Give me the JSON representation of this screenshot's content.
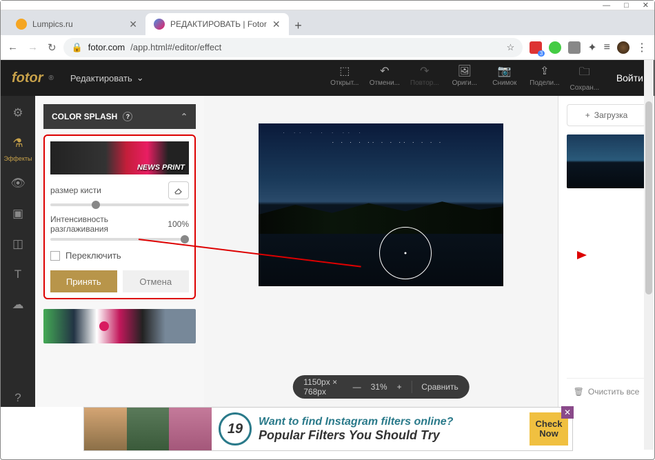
{
  "window": {
    "minimize": "—",
    "maximize": "□",
    "close": "✕"
  },
  "tabs": {
    "items": [
      {
        "label": "Lumpics.ru",
        "favicon": "#f5a623"
      },
      {
        "label": "РЕДАКТИРОВАТЬ | Fotor",
        "favicon": "#4a90e2"
      }
    ],
    "close": "✕",
    "new": "+"
  },
  "address": {
    "back": "←",
    "fwd": "→",
    "reload": "↻",
    "lock": "🔒",
    "domain": "fotor.com",
    "path": "/app.html#/editor/effect",
    "star": "☆"
  },
  "topbar": {
    "logo": "fotor",
    "reg": "®",
    "edit": "Редактировать",
    "chev": "⌄",
    "tools": [
      {
        "icon": "⬚",
        "label": "Открыт..."
      },
      {
        "icon": "↶",
        "label": "Отмени..."
      },
      {
        "icon": "↷",
        "label": "Повтор..."
      },
      {
        "icon": "🖼",
        "label": "Ориги..."
      },
      {
        "icon": "📷",
        "label": "Снимок"
      },
      {
        "icon": "⇪",
        "label": "Подели..."
      },
      {
        "icon": "🗀",
        "label": "Сохран..."
      }
    ],
    "login": "Войти"
  },
  "sidebar": {
    "active_label": "Эффекты",
    "icons": [
      "⚙",
      "⚗",
      "👁",
      "▣",
      "◫",
      "T",
      "☁",
      "?"
    ]
  },
  "panel": {
    "title": "COLOR SPLASH",
    "help": "?",
    "chev": "⌃",
    "preview_label": "NEWS PRINT",
    "brush_label": "размер кисти",
    "smooth_label": "Интенсивность разглаживания",
    "smooth_value": "100%",
    "toggle_label": "Переключить",
    "accept": "Принять",
    "cancel": "Отмена"
  },
  "zoom": {
    "dims": "1150px × 768px",
    "minus": "—",
    "pct": "31%",
    "plus": "+",
    "compare": "Сравнить"
  },
  "right": {
    "upload": "Загрузка",
    "plus": "+",
    "clear": "Очистить все",
    "trash": "🗑"
  },
  "ad": {
    "num": "19",
    "line1": "Want to find Instagram filters online?",
    "line2": "Popular Filters You Should Try",
    "cta1": "Check",
    "cta2": "Now",
    "close": "✕"
  }
}
